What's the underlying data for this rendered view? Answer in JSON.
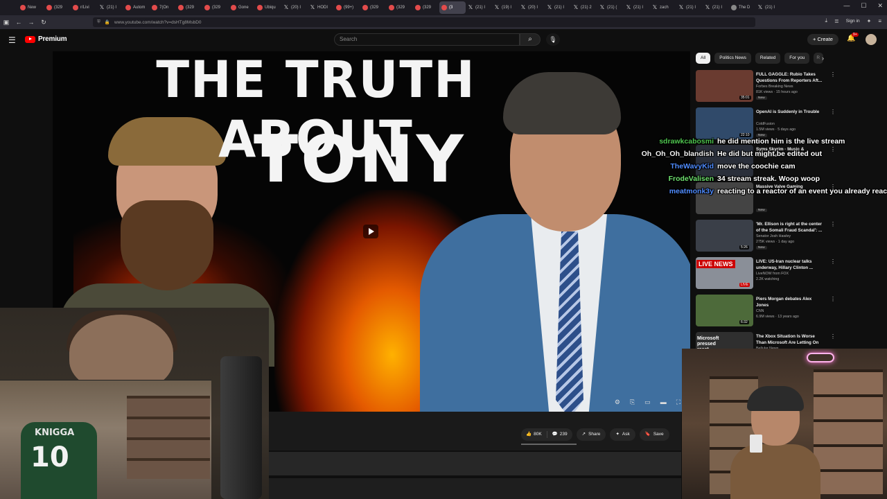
{
  "browser": {
    "tabs": [
      {
        "label": "New",
        "icon": "reddit-icon"
      },
      {
        "label": "(329",
        "icon": "youtube-icon"
      },
      {
        "label": "r/Livi",
        "icon": "reddit-icon"
      },
      {
        "label": "(21) I",
        "icon": "x-icon"
      },
      {
        "label": "Autom",
        "icon": "youtube-icon"
      },
      {
        "label": "7(On",
        "icon": "youtube-icon"
      },
      {
        "label": "(329",
        "icon": "youtube-icon"
      },
      {
        "label": "(329",
        "icon": "youtube-icon"
      },
      {
        "label": "Gone",
        "icon": "youtube-icon"
      },
      {
        "label": "Ubiqu",
        "icon": "youtube-icon"
      },
      {
        "label": "(20) I",
        "icon": "x-icon"
      },
      {
        "label": "HODI",
        "icon": "x-icon"
      },
      {
        "label": "(99+)",
        "icon": "youtube-icon"
      },
      {
        "label": "(329",
        "icon": "youtube-icon"
      },
      {
        "label": "(329",
        "icon": "youtube-icon"
      },
      {
        "label": "(329",
        "icon": "youtube-icon"
      },
      {
        "label": "(3",
        "icon": "youtube-icon",
        "active": true
      },
      {
        "label": "(21) I",
        "icon": "x-icon"
      },
      {
        "label": "(19) I",
        "icon": "x-icon"
      },
      {
        "label": "(20) I",
        "icon": "x-icon"
      },
      {
        "label": "(21) I",
        "icon": "x-icon"
      },
      {
        "label": "(21) 2",
        "icon": "x-icon"
      },
      {
        "label": "(21) (",
        "icon": "x-icon"
      },
      {
        "label": "(21) I",
        "icon": "x-icon"
      },
      {
        "label": "zach",
        "icon": "x-icon"
      },
      {
        "label": "(21) I",
        "icon": "x-icon"
      },
      {
        "label": "(21) I",
        "icon": "x-icon"
      },
      {
        "label": "The D",
        "icon": "globe-icon"
      },
      {
        "label": "(21) I",
        "icon": "x-icon"
      }
    ],
    "url": "www.youtube.com/watch?v=dsHTg8MsbD0",
    "sign_in": "Sign in"
  },
  "youtube": {
    "logo_text": "Premium",
    "search_placeholder": "Search",
    "create_label": "Create",
    "notif_count": "9+"
  },
  "video": {
    "thumbnail_title_line1": "THE TRUTH ABOUT",
    "thumbnail_title_line2": "TONY",
    "likes": "80K",
    "comments": "239",
    "share": "Share",
    "ask": "Ask",
    "save": "Save"
  },
  "sidebar": {
    "chips": [
      "All",
      "Politics News",
      "Related",
      "For you",
      "R"
    ],
    "recommendations": [
      {
        "title": "FULL GAGGLE: Rubio Takes Questions From Reporters Aft...",
        "channel": "Forbes Breaking News",
        "meta": "81K views · 15 hours ago",
        "badge": "New",
        "duration": "35:01",
        "thumb": "#6a3b30"
      },
      {
        "title": "OpenAI is Suddenly in Trouble",
        "channel": "ColdFusion",
        "meta": "1.5M views · 5 days ago",
        "badge": "New",
        "duration": "22:10",
        "thumb": "#304a6a"
      },
      {
        "title": "Syms Skyrim · Music & Ambience",
        "channel": "",
        "meta": "",
        "badge": "",
        "duration": "",
        "thumb": "#2a2f3a"
      },
      {
        "title": "Massive Valve Gaming",
        "channel": "",
        "meta": "",
        "badge": "New",
        "duration": "",
        "thumb": "#444"
      },
      {
        "title": "'Mr. Ellison is right at the center of the Somali Fraud Scandal': ...",
        "channel": "Senator Josh Hawley",
        "meta": "275K views · 1 day ago",
        "badge": "New",
        "duration": "5:26",
        "thumb": "#3a3f48"
      },
      {
        "title": "LIVE: US-Iran nuclear talks underway, Hillary Clinton ...",
        "channel": "LiveNOW from FOX",
        "meta": "2.2K watching",
        "badge": "",
        "duration": "LIVE",
        "thumb": "#8a8f98",
        "live_label": "LIVE NEWS"
      },
      {
        "title": "Piers Morgan debates Alex Jones",
        "channel": "CNN",
        "meta": "6.9M views · 13 years ago",
        "badge": "",
        "duration": "6:32",
        "thumb": "#4d6a3a"
      },
      {
        "title": "The Xbox Situation Is Worse Than Microsoft Are Letting On",
        "channel": "Bellular News",
        "meta": "",
        "badge": "",
        "duration": "",
        "thumb": "#2f2f2f",
        "thumb_text": "Microsoft pressed reset"
      }
    ]
  },
  "chat": [
    {
      "user": "sdrawkcabosmi",
      "color": "#4ec44e",
      "message": "he did mention him is the live stream"
    },
    {
      "user": "Oh_Oh_Oh_blandish",
      "color": "#f0f0f0",
      "message": "He did but might be edited out"
    },
    {
      "user": "TheWavyKid",
      "color": "#4f8cff",
      "message": "move the coochie cam"
    },
    {
      "user": "FrodeValisen",
      "color": "#6ee06e",
      "message": "34 stream streak. Woop woop"
    },
    {
      "user": "meatmonk3y",
      "color": "#4f8cff",
      "message": "reacting to a reactor of an event you already reacted to about someone you know 🤮"
    }
  ],
  "webcam": {
    "jersey_name": "KNIGGA",
    "jersey_number": "10"
  }
}
